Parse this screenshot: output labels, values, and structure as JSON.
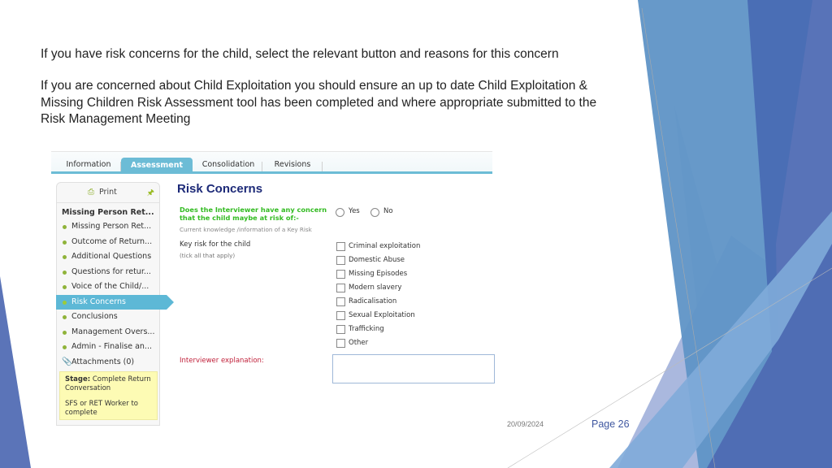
{
  "slide": {
    "line1": "If you have risk concerns for the child, select the relevant button and reasons for this concern",
    "para2": "If you are concerned about Child Exploitation you should ensure an up to date Child Exploitation & Missing Children Risk Assessment tool has been completed and where appropriate submitted to the Risk Management Meeting",
    "date": "20/09/2024",
    "page": "Page 26",
    "theme_colors": [
      "#4a6eb5",
      "#5f93c6",
      "#7fa8d8",
      "#c8d0e8",
      "#5b74b8"
    ]
  },
  "app": {
    "tabs": [
      {
        "label": "Information",
        "active": false
      },
      {
        "label": "Assessment",
        "active": true
      },
      {
        "label": "Consolidation",
        "active": false
      },
      {
        "label": "Revisions",
        "active": false
      }
    ],
    "sidebar": {
      "print_label": "Print",
      "print_icon": "printer-icon",
      "pin_icon": "pin-icon",
      "heading": "Missing Person Ret...",
      "items": [
        {
          "label": "Missing Person Ret...",
          "active": false
        },
        {
          "label": "Outcome of Return...",
          "active": false
        },
        {
          "label": "Additional Questions",
          "active": false
        },
        {
          "label": "Questions for retur...",
          "active": false
        },
        {
          "label": "Voice of the Child/...",
          "active": false
        },
        {
          "label": "Risk Concerns",
          "active": true
        },
        {
          "label": "Conclusions",
          "active": false
        },
        {
          "label": "Management Overs...",
          "active": false
        },
        {
          "label": "Admin - Finalise an...",
          "active": false
        }
      ],
      "attachments": "Attachments (0)",
      "stage_label": "Stage:",
      "stage_value": "Complete Return Conversation",
      "stage_note": "SFS or RET Worker to complete"
    },
    "main": {
      "title": "Risk Concerns",
      "question": "Does the Interviewer have any concern that the child maybe at risk of:-",
      "question_hint": "Current knowledge /information of a Key Risk",
      "radio_options": [
        "Yes",
        "No"
      ],
      "radio_selected": null,
      "key_risk_label": "Key risk for the child",
      "key_risk_hint": "(tick all that apply)",
      "checkboxes": [
        {
          "label": "Criminal exploitation",
          "checked": false
        },
        {
          "label": "Domestic Abuse",
          "checked": false
        },
        {
          "label": "Missing Episodes",
          "checked": false
        },
        {
          "label": "Modern slavery",
          "checked": false
        },
        {
          "label": "Radicalisation",
          "checked": false
        },
        {
          "label": "Sexual Exploitation",
          "checked": false
        },
        {
          "label": "Trafficking",
          "checked": false
        },
        {
          "label": "Other",
          "checked": false
        }
      ],
      "explanation_label": "Interviewer explanation:",
      "explanation_value": ""
    }
  }
}
